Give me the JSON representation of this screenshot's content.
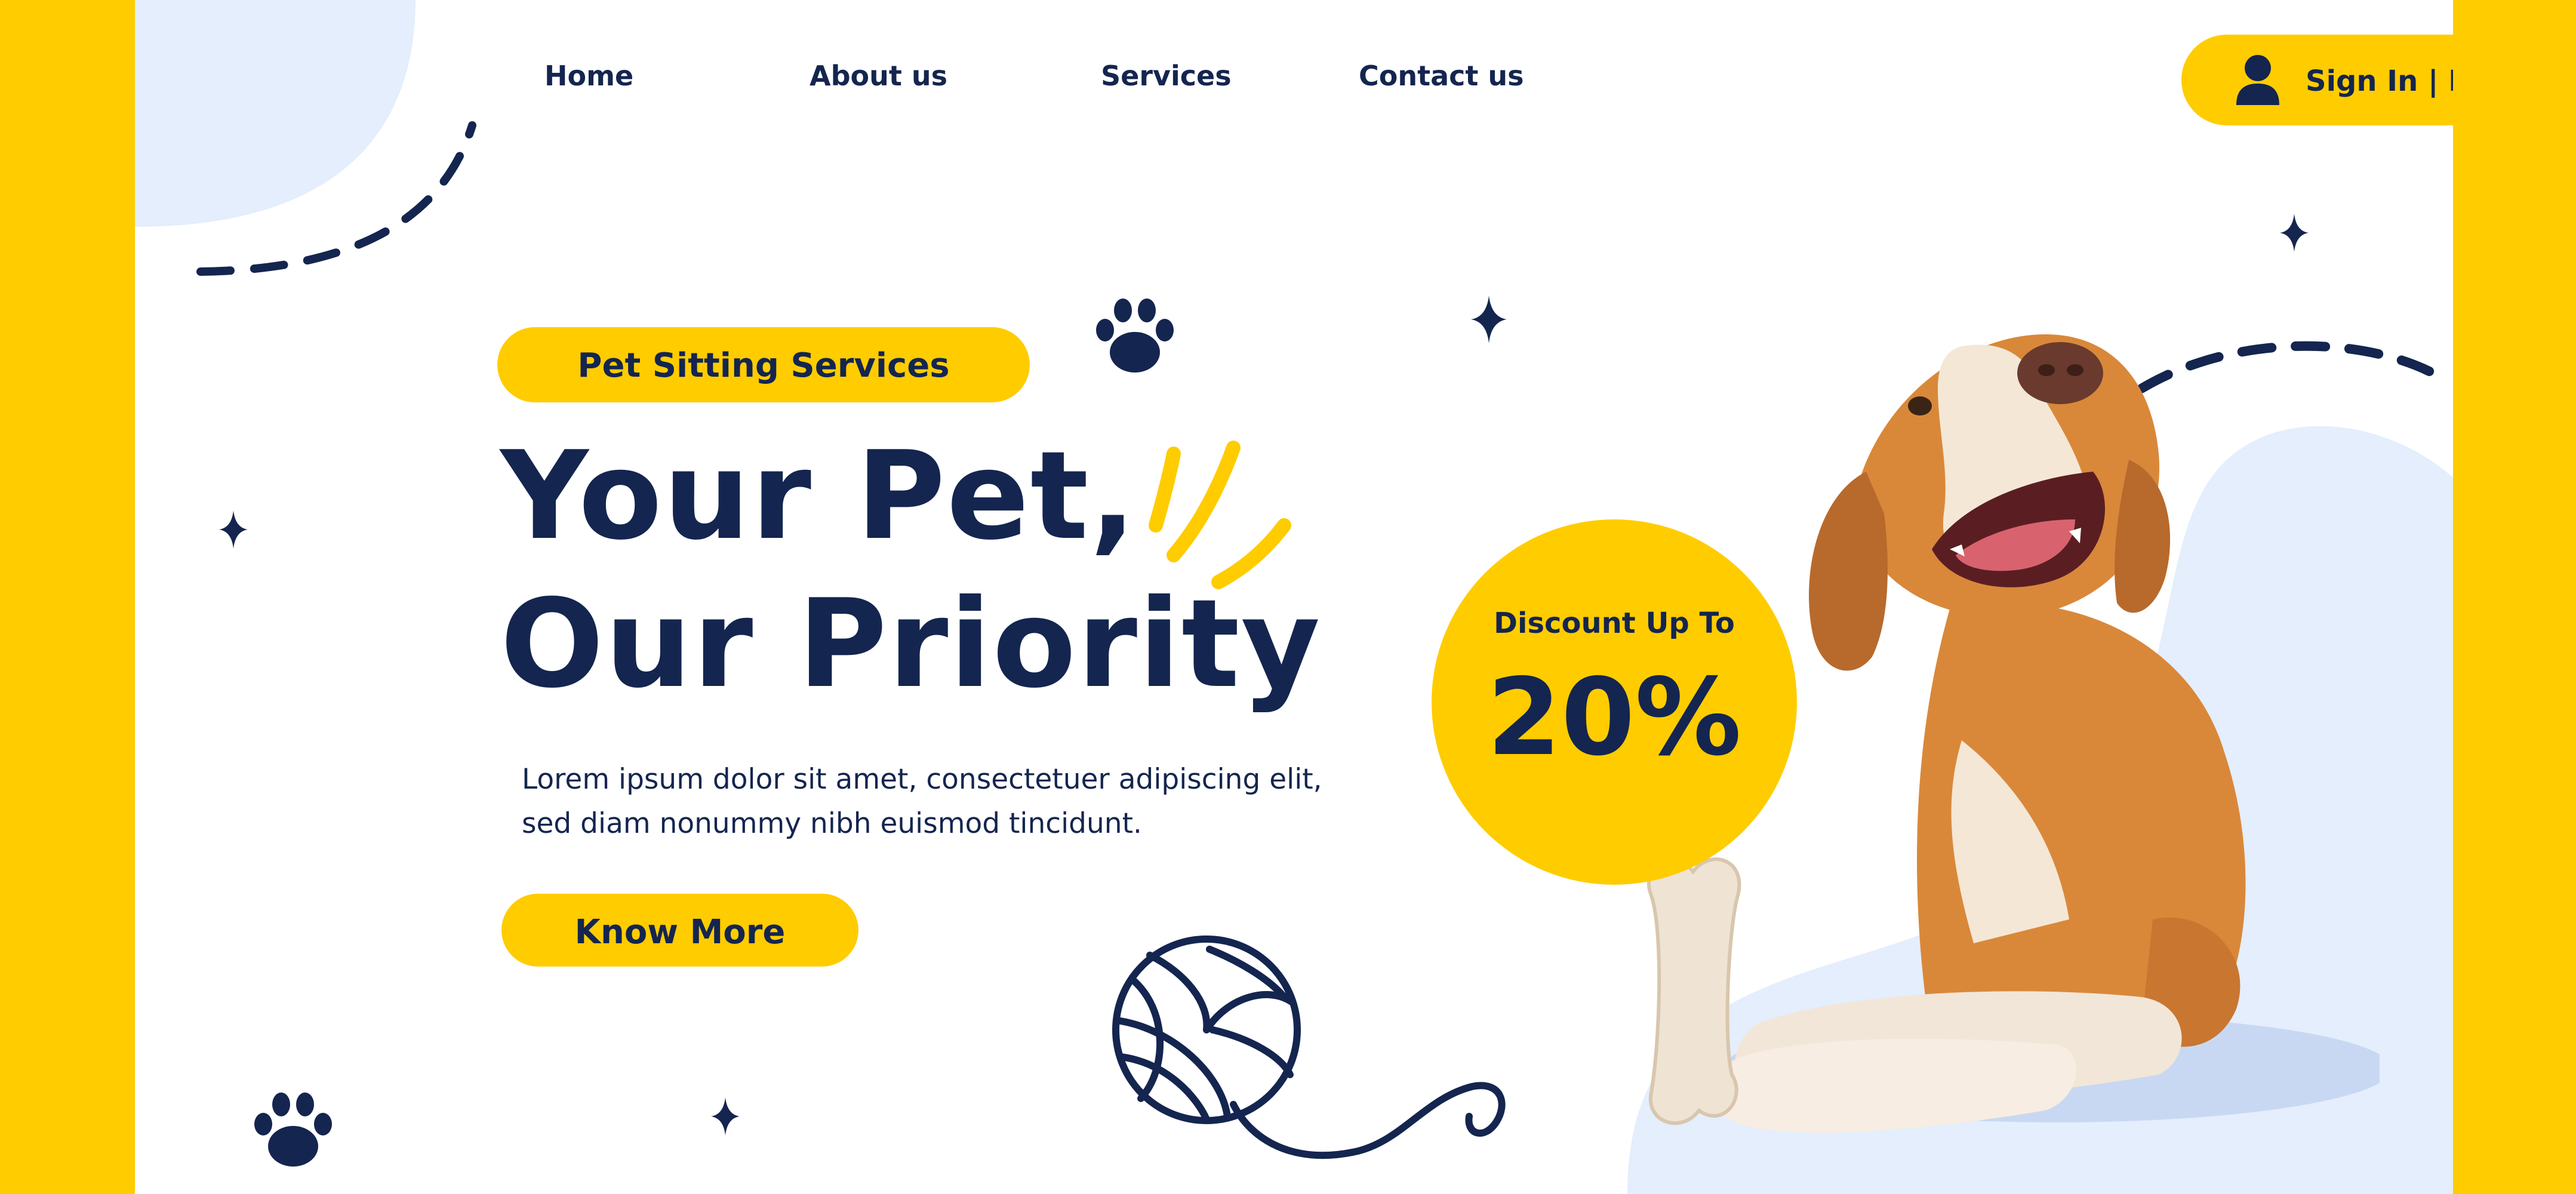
{
  "nav": {
    "items": [
      {
        "label": "Home"
      },
      {
        "label": "About us"
      },
      {
        "label": "Services"
      },
      {
        "label": "Contact us"
      }
    ],
    "signin_label": "Sign In | Log In",
    "signin_icon": "user-icon"
  },
  "hero": {
    "tag_label": "Pet Sitting Services",
    "headline_line1": "Your Pet,",
    "headline_line2": "Our Priority",
    "body_line1": "Lorem ipsum dolor sit amet, consectetuer adipiscing elit,",
    "body_line2": "sed diam nonummy nibh euismod tincidunt.",
    "cta_label": "Know More"
  },
  "promo": {
    "label": "Discount Up To",
    "value": "20%"
  },
  "decorations": {
    "icons": [
      "paw-icon",
      "sparkle-icon",
      "yarn-ball-icon",
      "motion-lines-icon",
      "dashed-arc-icon"
    ],
    "photo": "dog-photo"
  },
  "colors": {
    "accent": "#FFCC00",
    "navy": "#14254F",
    "blob": "#E4EEFC",
    "background": "#FFFFFF"
  }
}
